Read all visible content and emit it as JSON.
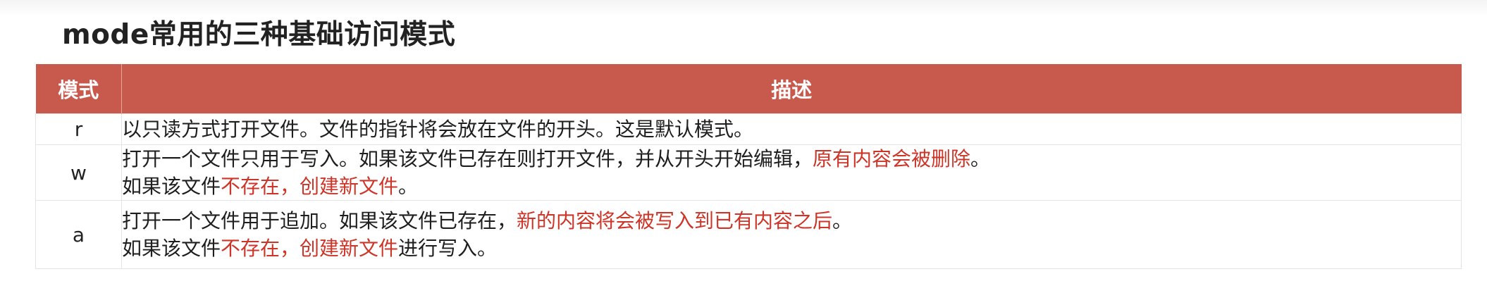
{
  "title": "mode常用的三种基础访问模式",
  "table": {
    "headers": {
      "mode": "模式",
      "desc": "描述"
    },
    "rows": [
      {
        "mode": "r",
        "lines": [
          {
            "a": "以只读方式打开文件。文件的指针将会放在文件的开头。这是默认模式。"
          }
        ]
      },
      {
        "mode": "w",
        "lines": [
          {
            "a": "打开一个文件只用于写入。如果该文件已存在则打开文件，并从开头开始编辑，",
            "b": "原有内容会被删除",
            "c": "。"
          },
          {
            "a": "如果该文件",
            "b": "不存在，创建新文件",
            "c": "。"
          }
        ]
      },
      {
        "mode": "a",
        "lines": [
          {
            "a": "打开一个文件用于追加。如果该文件已存在，",
            "b": "新的内容将会被写入到已有内容之后",
            "c": "。"
          },
          {
            "a": "如果该文件",
            "b": "不存在，创建新文件",
            "c": "进行写入。"
          }
        ]
      }
    ]
  },
  "colors": {
    "header_bg": "#c85a4d",
    "highlight": "#cc3527"
  }
}
